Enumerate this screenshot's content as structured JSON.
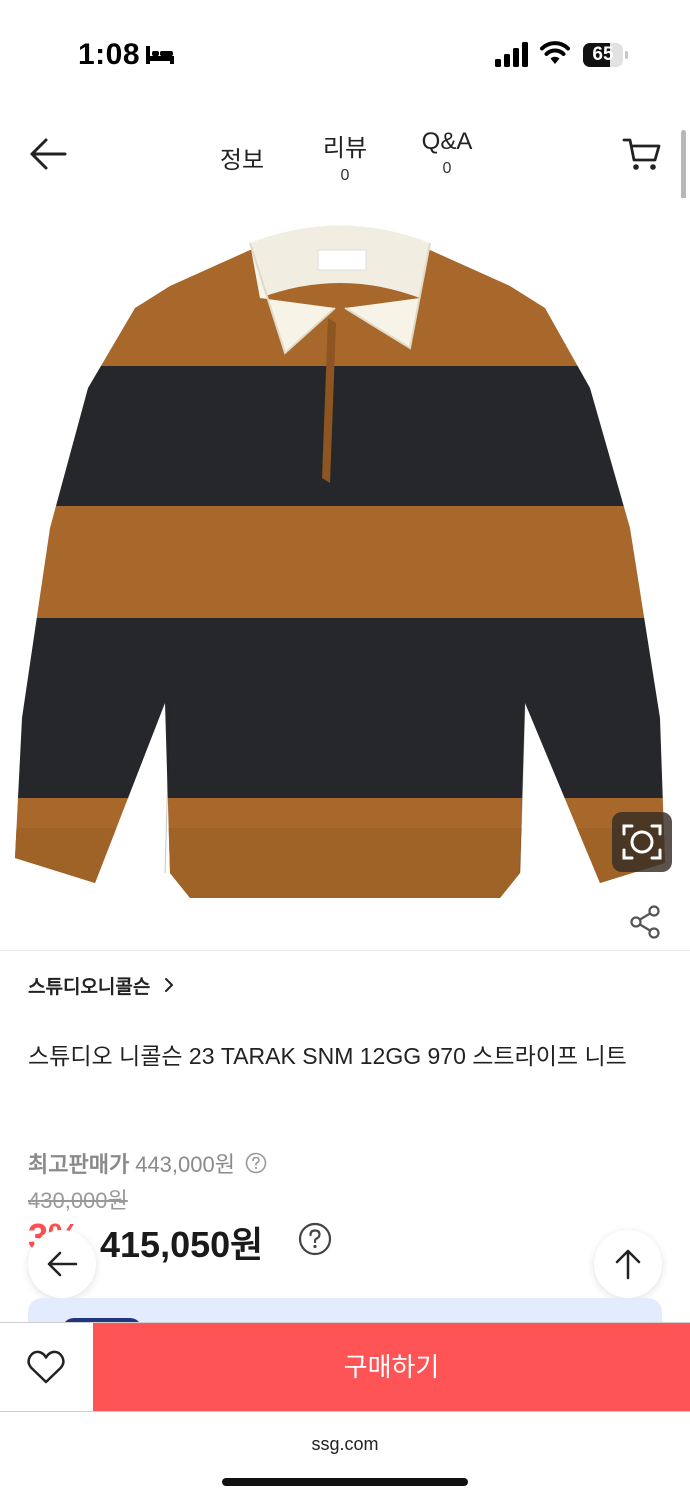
{
  "status_bar": {
    "time": "1:08",
    "battery": "65",
    "icons": [
      "bed-icon",
      "signal-icon",
      "wifi-icon",
      "battery-icon"
    ]
  },
  "nav": {
    "icons": [
      "back-arrow-icon",
      "cart-icon"
    ],
    "tabs": [
      {
        "label": "정보"
      },
      {
        "label": "리뷰",
        "count": "0"
      },
      {
        "label": "Q&A",
        "count": "0"
      }
    ]
  },
  "product_image": {
    "icons": [
      "visual-search-icon",
      "share-icon"
    ],
    "colors": {
      "brown": "#a8682b",
      "black": "#25272b",
      "collar": "#f7f3e6"
    }
  },
  "product": {
    "brand": "스튜디오니콜슨",
    "title": "스튜디오 니콜슨 23 TARAK SNM 12GG 970 스트라이프 니트",
    "top_price_label": "최고판매가",
    "top_price_value": "443,000원",
    "original_price": "430,000원",
    "discount_rate": "3%",
    "sale_price": "415,050원"
  },
  "floating_buttons": {
    "icons": [
      "back-arrow-icon",
      "arrow-up-icon"
    ]
  },
  "bottom_bar": {
    "buy_label": "구매하기",
    "icons": [
      "heart-icon"
    ],
    "colors": {
      "buy": "#ff5455"
    }
  },
  "browser": {
    "url": "ssg.com"
  }
}
